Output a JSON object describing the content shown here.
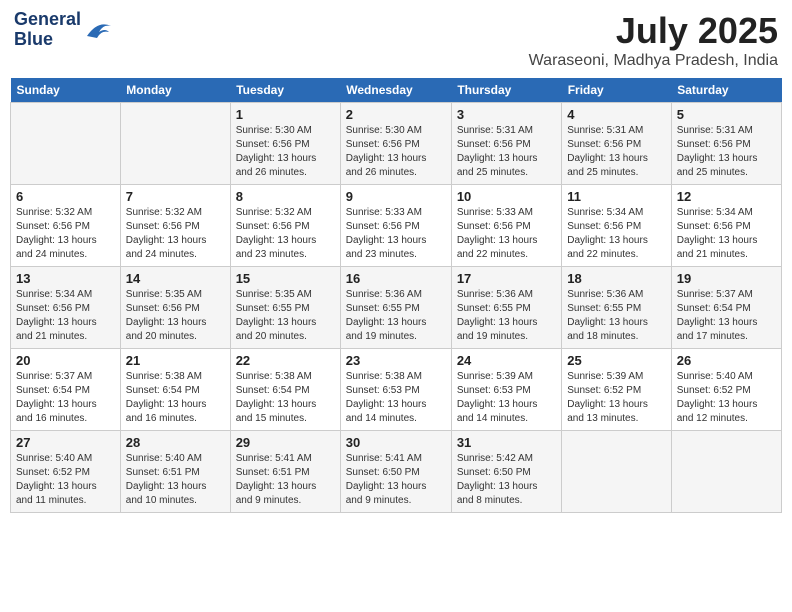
{
  "header": {
    "logo_line1": "General",
    "logo_line2": "Blue",
    "month": "July 2025",
    "location": "Waraseoni, Madhya Pradesh, India"
  },
  "days_of_week": [
    "Sunday",
    "Monday",
    "Tuesday",
    "Wednesday",
    "Thursday",
    "Friday",
    "Saturday"
  ],
  "weeks": [
    [
      {
        "num": "",
        "info": ""
      },
      {
        "num": "",
        "info": ""
      },
      {
        "num": "1",
        "info": "Sunrise: 5:30 AM\nSunset: 6:56 PM\nDaylight: 13 hours\nand 26 minutes."
      },
      {
        "num": "2",
        "info": "Sunrise: 5:30 AM\nSunset: 6:56 PM\nDaylight: 13 hours\nand 26 minutes."
      },
      {
        "num": "3",
        "info": "Sunrise: 5:31 AM\nSunset: 6:56 PM\nDaylight: 13 hours\nand 25 minutes."
      },
      {
        "num": "4",
        "info": "Sunrise: 5:31 AM\nSunset: 6:56 PM\nDaylight: 13 hours\nand 25 minutes."
      },
      {
        "num": "5",
        "info": "Sunrise: 5:31 AM\nSunset: 6:56 PM\nDaylight: 13 hours\nand 25 minutes."
      }
    ],
    [
      {
        "num": "6",
        "info": "Sunrise: 5:32 AM\nSunset: 6:56 PM\nDaylight: 13 hours\nand 24 minutes."
      },
      {
        "num": "7",
        "info": "Sunrise: 5:32 AM\nSunset: 6:56 PM\nDaylight: 13 hours\nand 24 minutes."
      },
      {
        "num": "8",
        "info": "Sunrise: 5:32 AM\nSunset: 6:56 PM\nDaylight: 13 hours\nand 23 minutes."
      },
      {
        "num": "9",
        "info": "Sunrise: 5:33 AM\nSunset: 6:56 PM\nDaylight: 13 hours\nand 23 minutes."
      },
      {
        "num": "10",
        "info": "Sunrise: 5:33 AM\nSunset: 6:56 PM\nDaylight: 13 hours\nand 22 minutes."
      },
      {
        "num": "11",
        "info": "Sunrise: 5:34 AM\nSunset: 6:56 PM\nDaylight: 13 hours\nand 22 minutes."
      },
      {
        "num": "12",
        "info": "Sunrise: 5:34 AM\nSunset: 6:56 PM\nDaylight: 13 hours\nand 21 minutes."
      }
    ],
    [
      {
        "num": "13",
        "info": "Sunrise: 5:34 AM\nSunset: 6:56 PM\nDaylight: 13 hours\nand 21 minutes."
      },
      {
        "num": "14",
        "info": "Sunrise: 5:35 AM\nSunset: 6:56 PM\nDaylight: 13 hours\nand 20 minutes."
      },
      {
        "num": "15",
        "info": "Sunrise: 5:35 AM\nSunset: 6:55 PM\nDaylight: 13 hours\nand 20 minutes."
      },
      {
        "num": "16",
        "info": "Sunrise: 5:36 AM\nSunset: 6:55 PM\nDaylight: 13 hours\nand 19 minutes."
      },
      {
        "num": "17",
        "info": "Sunrise: 5:36 AM\nSunset: 6:55 PM\nDaylight: 13 hours\nand 19 minutes."
      },
      {
        "num": "18",
        "info": "Sunrise: 5:36 AM\nSunset: 6:55 PM\nDaylight: 13 hours\nand 18 minutes."
      },
      {
        "num": "19",
        "info": "Sunrise: 5:37 AM\nSunset: 6:54 PM\nDaylight: 13 hours\nand 17 minutes."
      }
    ],
    [
      {
        "num": "20",
        "info": "Sunrise: 5:37 AM\nSunset: 6:54 PM\nDaylight: 13 hours\nand 16 minutes."
      },
      {
        "num": "21",
        "info": "Sunrise: 5:38 AM\nSunset: 6:54 PM\nDaylight: 13 hours\nand 16 minutes."
      },
      {
        "num": "22",
        "info": "Sunrise: 5:38 AM\nSunset: 6:54 PM\nDaylight: 13 hours\nand 15 minutes."
      },
      {
        "num": "23",
        "info": "Sunrise: 5:38 AM\nSunset: 6:53 PM\nDaylight: 13 hours\nand 14 minutes."
      },
      {
        "num": "24",
        "info": "Sunrise: 5:39 AM\nSunset: 6:53 PM\nDaylight: 13 hours\nand 14 minutes."
      },
      {
        "num": "25",
        "info": "Sunrise: 5:39 AM\nSunset: 6:52 PM\nDaylight: 13 hours\nand 13 minutes."
      },
      {
        "num": "26",
        "info": "Sunrise: 5:40 AM\nSunset: 6:52 PM\nDaylight: 13 hours\nand 12 minutes."
      }
    ],
    [
      {
        "num": "27",
        "info": "Sunrise: 5:40 AM\nSunset: 6:52 PM\nDaylight: 13 hours\nand 11 minutes."
      },
      {
        "num": "28",
        "info": "Sunrise: 5:40 AM\nSunset: 6:51 PM\nDaylight: 13 hours\nand 10 minutes."
      },
      {
        "num": "29",
        "info": "Sunrise: 5:41 AM\nSunset: 6:51 PM\nDaylight: 13 hours\nand 9 minutes."
      },
      {
        "num": "30",
        "info": "Sunrise: 5:41 AM\nSunset: 6:50 PM\nDaylight: 13 hours\nand 9 minutes."
      },
      {
        "num": "31",
        "info": "Sunrise: 5:42 AM\nSunset: 6:50 PM\nDaylight: 13 hours\nand 8 minutes."
      },
      {
        "num": "",
        "info": ""
      },
      {
        "num": "",
        "info": ""
      }
    ]
  ]
}
